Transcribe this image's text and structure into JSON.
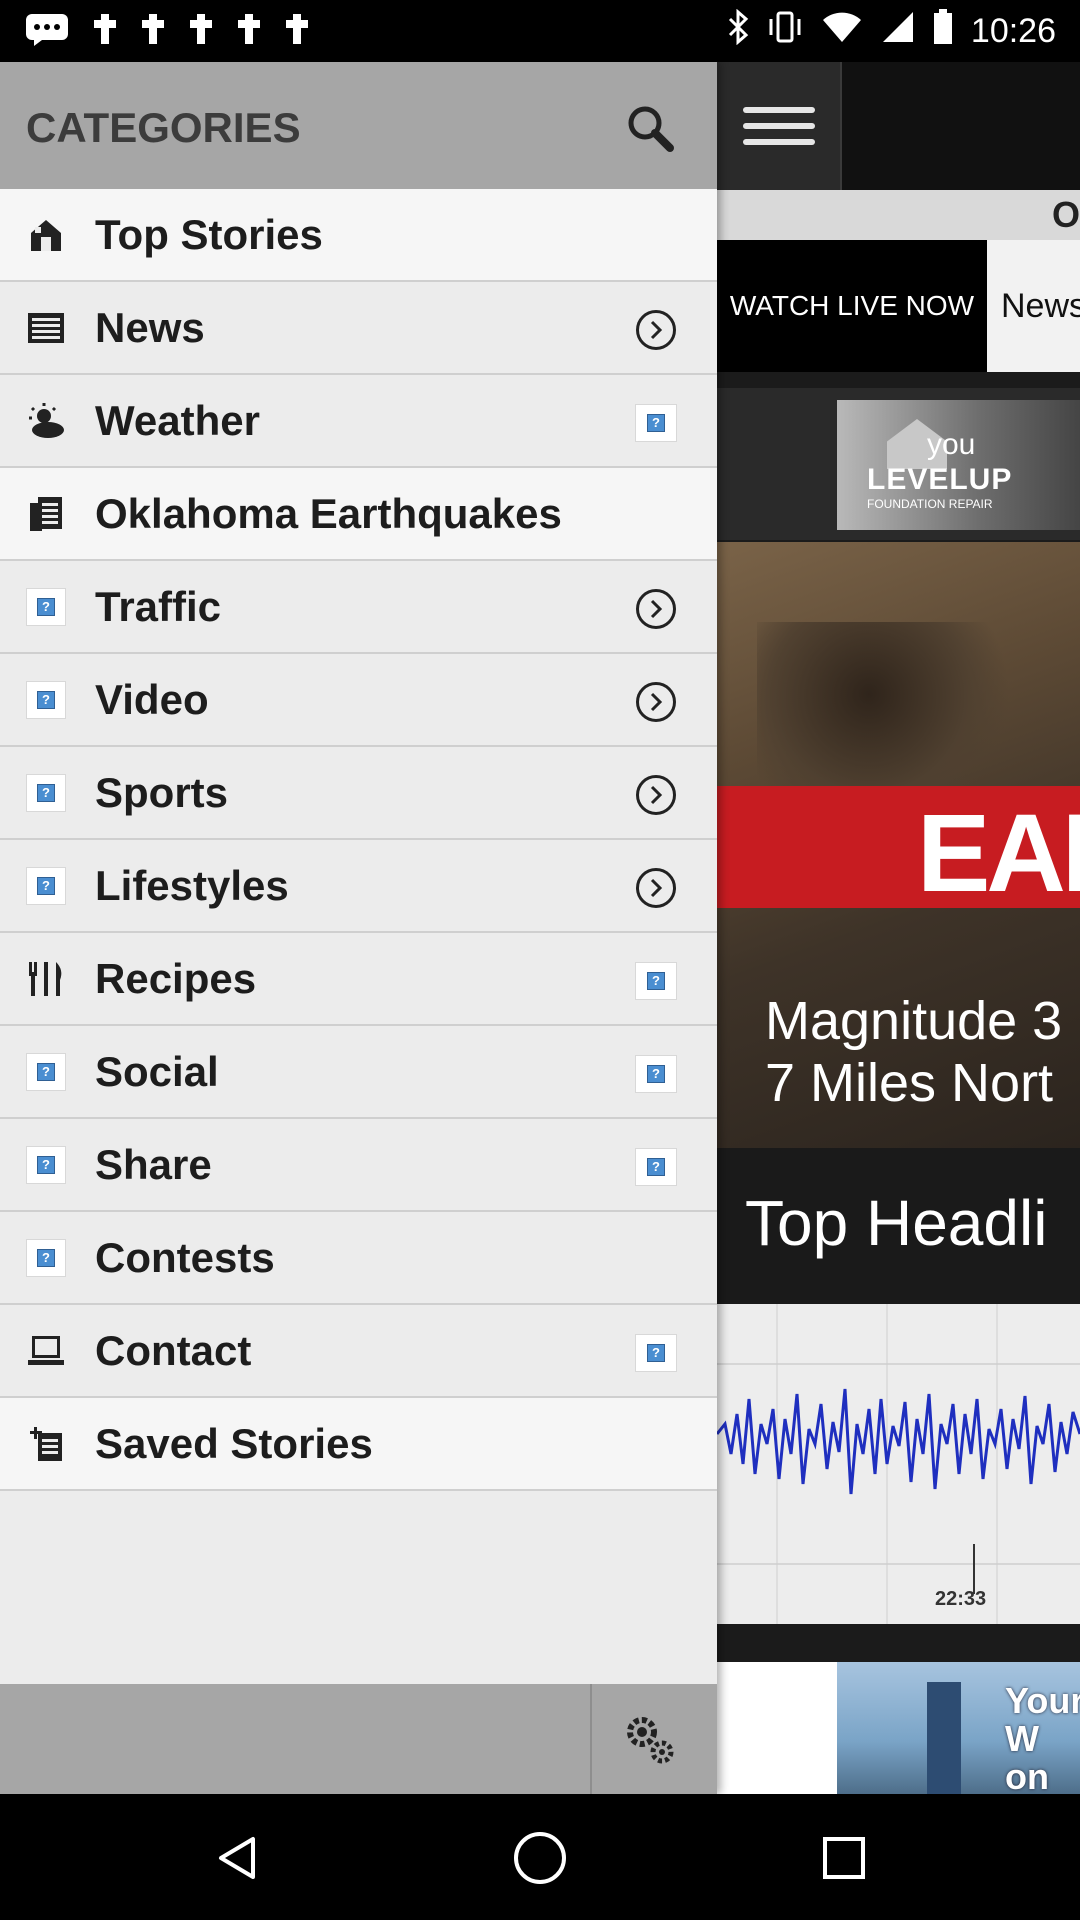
{
  "status_bar": {
    "time": "10:26",
    "left_icons": [
      "chat-bubble-icon",
      "notification-flag-icon",
      "notification-flag-icon",
      "notification-flag-icon",
      "notification-flag-icon",
      "notification-flag-icon"
    ],
    "right_icons": [
      "bluetooth-icon",
      "vibrate-icon",
      "wifi-icon",
      "signal-icon",
      "battery-icon"
    ]
  },
  "drawer": {
    "title": "CATEGORIES",
    "items": [
      {
        "label": "Top Stories",
        "icon": "home-icon",
        "right": "none"
      },
      {
        "label": "News",
        "icon": "newspaper-icon",
        "right": "chevron"
      },
      {
        "label": "Weather",
        "icon": "weather-sun-cloud-icon",
        "right": "placeholder"
      },
      {
        "label": "Oklahoma Earthquakes",
        "icon": "document-icon",
        "right": "none"
      },
      {
        "label": "Traffic",
        "icon": "placeholder-image-icon",
        "right": "chevron"
      },
      {
        "label": "Video",
        "icon": "placeholder-image-icon",
        "right": "chevron"
      },
      {
        "label": "Sports",
        "icon": "placeholder-image-icon",
        "right": "chevron"
      },
      {
        "label": "Lifestyles",
        "icon": "placeholder-image-icon",
        "right": "chevron"
      },
      {
        "label": "Recipes",
        "icon": "fork-knife-icon",
        "right": "placeholder"
      },
      {
        "label": "Social",
        "icon": "placeholder-image-icon",
        "right": "placeholder"
      },
      {
        "label": "Share",
        "icon": "placeholder-image-icon",
        "right": "placeholder"
      },
      {
        "label": "Contests",
        "icon": "placeholder-image-icon",
        "right": "none"
      },
      {
        "label": "Contact",
        "icon": "laptop-icon",
        "right": "placeholder"
      },
      {
        "label": "Saved Stories",
        "icon": "saved-document-icon",
        "right": "none"
      }
    ]
  },
  "content": {
    "strip_text": "O",
    "watch_live": "WATCH LIVE NOW",
    "news_tab": "News",
    "ad_brand": "LEVELUP",
    "ad_brand_sub": "FOUNDATION REPAIR",
    "ad_side_text": "you",
    "hero_banner": "EAR",
    "hero_caption_line1": "Magnitude 3",
    "hero_caption_line2": "7 Miles Nort",
    "section_title": "Top Headli",
    "seismo_time": "22:33",
    "bottom_ad_line1": "Your W",
    "bottom_ad_line2": "on Ok"
  },
  "colors": {
    "drawer_bg": "#ececec",
    "drawer_header": "#a6a6a6",
    "banner_red": "#c71c21",
    "seismo_wave": "#1f2fbf"
  }
}
